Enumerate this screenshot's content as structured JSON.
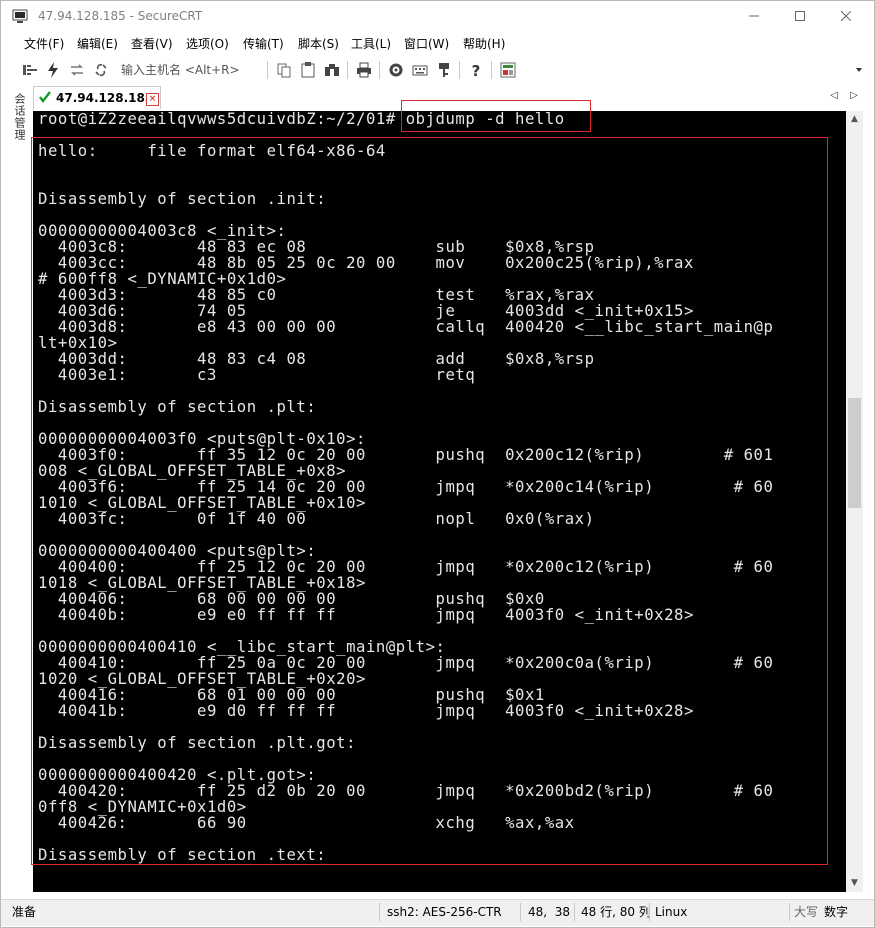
{
  "window": {
    "title": "47.94.128.185 - SecureCRT",
    "controls": {
      "minimize": "—",
      "maximize": "☐",
      "close": "✕"
    }
  },
  "menu": {
    "items": [
      "文件(F)",
      "编辑(E)",
      "查看(V)",
      "选项(O)",
      "传输(T)",
      "脚本(S)",
      "工具(L)",
      "窗口(W)",
      "帮助(H)"
    ]
  },
  "toolbar": {
    "quick_connect_placeholder": "输入主机名 <Alt+R>"
  },
  "sidebar": {
    "session_manager_label": "会话管理"
  },
  "tabs": {
    "active": {
      "label": "47.94.128.185",
      "close_glyph": "×"
    },
    "nav_prev": "◁",
    "nav_next": "▷"
  },
  "terminal": {
    "lines": [
      "root@iZ2zeeailqvwws5dcuivdbZ:~/2/01# objdump -d hello",
      "",
      "hello:     file format elf64-x86-64",
      "",
      "",
      "Disassembly of section .init:",
      "",
      "00000000004003c8 <_init>:",
      "  4003c8:       48 83 ec 08             sub    $0x8,%rsp",
      "  4003cc:       48 8b 05 25 0c 20 00    mov    0x200c25(%rip),%rax",
      "# 600ff8 <_DYNAMIC+0x1d0>",
      "  4003d3:       48 85 c0                test   %rax,%rax",
      "  4003d6:       74 05                   je     4003dd <_init+0x15>",
      "  4003d8:       e8 43 00 00 00          callq  400420 <__libc_start_main@p",
      "lt+0x10>",
      "  4003dd:       48 83 c4 08             add    $0x8,%rsp",
      "  4003e1:       c3                      retq",
      "",
      "Disassembly of section .plt:",
      "",
      "00000000004003f0 <puts@plt-0x10>:",
      "  4003f0:       ff 35 12 0c 20 00       pushq  0x200c12(%rip)        # 601",
      "008 <_GLOBAL_OFFSET_TABLE_+0x8>",
      "  4003f6:       ff 25 14 0c 20 00       jmpq   *0x200c14(%rip)        # 60",
      "1010 <_GLOBAL_OFFSET_TABLE_+0x10>",
      "  4003fc:       0f 1f 40 00             nopl   0x0(%rax)",
      "",
      "0000000000400400 <puts@plt>:",
      "  400400:       ff 25 12 0c 20 00       jmpq   *0x200c12(%rip)        # 60",
      "1018 <_GLOBAL_OFFSET_TABLE_+0x18>",
      "  400406:       68 00 00 00 00          pushq  $0x0",
      "  40040b:       e9 e0 ff ff ff          jmpq   4003f0 <_init+0x28>",
      "",
      "0000000000400410 <__libc_start_main@plt>:",
      "  400410:       ff 25 0a 0c 20 00       jmpq   *0x200c0a(%rip)        # 60",
      "1020 <_GLOBAL_OFFSET_TABLE_+0x20>",
      "  400416:       68 01 00 00 00          pushq  $0x1",
      "  40041b:       e9 d0 ff ff ff          jmpq   4003f0 <_init+0x28>",
      "",
      "Disassembly of section .plt.got:",
      "",
      "0000000000400420 <.plt.got>:",
      "  400420:       ff 25 d2 0b 20 00       jmpq   *0x200bd2(%rip)        # 60",
      "0ff8 <_DYNAMIC+0x1d0>",
      "  400426:       66 90                   xchg   %ax,%ax",
      "",
      "Disassembly of section .text:"
    ]
  },
  "status": {
    "ready": "准备",
    "encryption": "ssh2: AES-256-CTR",
    "cursor": "48,  38",
    "size": "48 行, 80 列",
    "terminal_type": "Linux",
    "caps": "大写",
    "num": "数字"
  },
  "colors": {
    "terminal_bg": "#000000",
    "terminal_fg": "#e6e6e6",
    "highlight": "#e0282c"
  }
}
